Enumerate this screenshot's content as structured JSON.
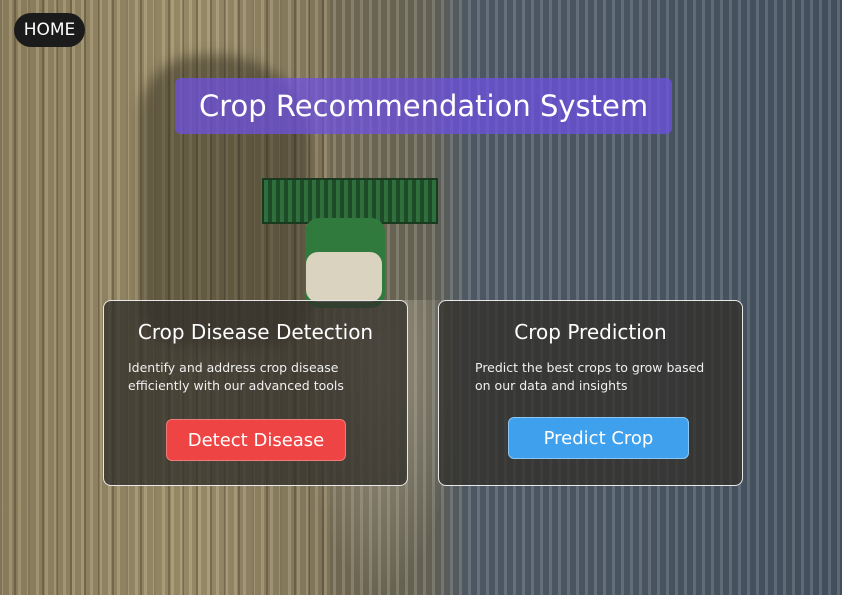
{
  "nav": {
    "home_label": "HOME"
  },
  "header": {
    "title": "Crop Recommendation System"
  },
  "cards": [
    {
      "title": "Crop Disease Detection",
      "description": "Identify and address crop disease efficiently with our advanced tools",
      "button_label": "Detect Disease",
      "button_color": "#ee4444"
    },
    {
      "title": "Crop Prediction",
      "description": "Predict the best crops to grow based on our data and insights",
      "button_label": "Predict Crop",
      "button_color": "#3fa1ee"
    }
  ],
  "colors": {
    "title_background": "#6e50e6",
    "home_background": "#1b1b1b"
  }
}
